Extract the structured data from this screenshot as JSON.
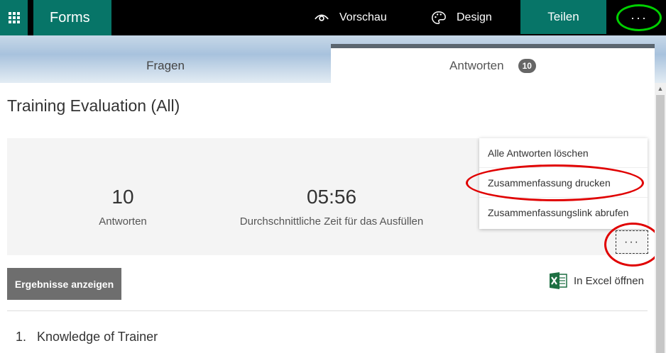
{
  "topbar": {
    "app_name": "Forms",
    "preview_label": "Vorschau",
    "design_label": "Design",
    "share_label": "Teilen",
    "more_label": "···"
  },
  "tabs": {
    "questions_label": "Fragen",
    "responses_label": "Antworten",
    "responses_count": "10"
  },
  "form": {
    "title": "Training Evaluation (All)"
  },
  "stats": {
    "responses_value": "10",
    "responses_label": "Antworten",
    "avg_time_value": "05:56",
    "avg_time_label": "Durchschnittliche Zeit für das Ausfüllen",
    "more_label": "···"
  },
  "menu": {
    "items": [
      {
        "label": "Alle Antworten löschen"
      },
      {
        "label": "Zusammenfassung drucken"
      },
      {
        "label": "Zusammenfassungslink abrufen"
      }
    ]
  },
  "actions": {
    "view_results_label": "Ergebnisse anzeigen",
    "open_excel_label": "In Excel öffnen"
  },
  "questions": [
    {
      "number": "1.",
      "title": "Knowledge of Trainer"
    }
  ],
  "colors": {
    "brand": "#077568",
    "topbar": "#000000",
    "highlight_green": "#00d000",
    "highlight_red": "#e00000"
  },
  "icons": {
    "app_launcher": "waffle-icon",
    "preview": "eye-icon",
    "design": "palette-icon",
    "excel": "excel-icon"
  }
}
